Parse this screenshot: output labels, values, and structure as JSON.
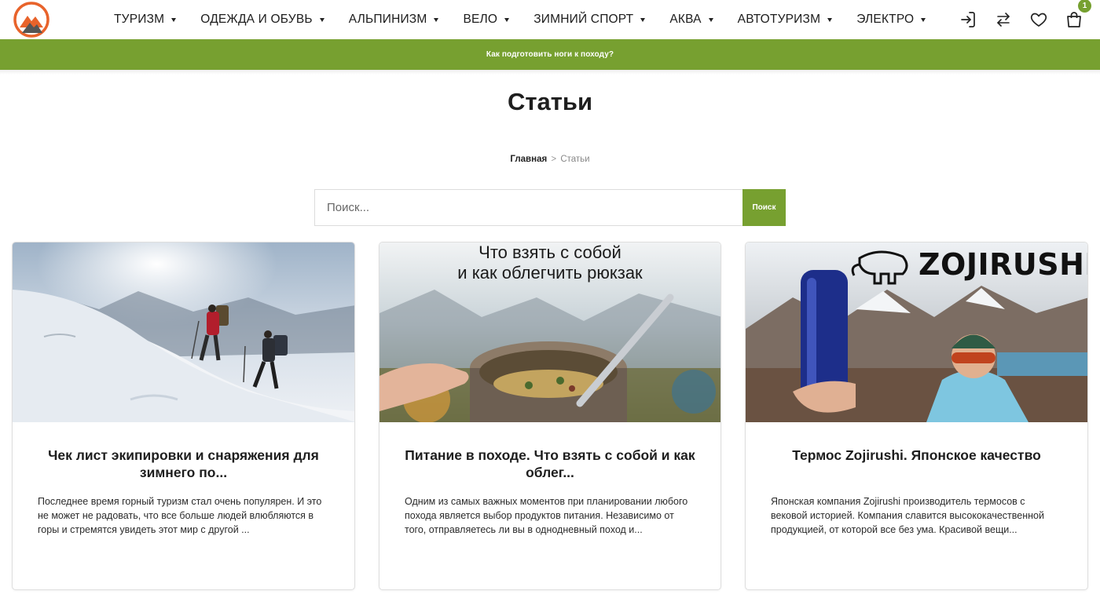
{
  "header": {
    "nav": [
      {
        "label": "ТУРИЗМ"
      },
      {
        "label": "ОДЕЖДА И ОБУВЬ"
      },
      {
        "label": "АЛЬПИНИЗМ"
      },
      {
        "label": "ВЕЛО"
      },
      {
        "label": "ЗИМНИЙ СПОРТ"
      },
      {
        "label": "АКВА"
      },
      {
        "label": "АВТОТУРИЗМ"
      },
      {
        "label": "ЭЛЕКТРО"
      }
    ],
    "icons": [
      "login-icon",
      "compare-icon",
      "heart-icon",
      "shopping-bag-icon"
    ],
    "cart_count": "1"
  },
  "promo": {
    "text": "Как подготовить ноги к походу?"
  },
  "page": {
    "title": "Статьи"
  },
  "breadcrumb": {
    "home": "Главная",
    "separator": ">",
    "current": "Статьи"
  },
  "search": {
    "placeholder": "Поиск...",
    "button_label": "Поиск"
  },
  "articles": [
    {
      "title": "Чек лист экипировки и снаряжения для зимнего по...",
      "excerpt": "Последнее время горный туризм стал очень популярен. И это не может не радовать, что все больше людей влюбляются в горы и стремятся увидеть этот мир с другой ..."
    },
    {
      "title": "Питание в походе. Что взять с собой и как облег...",
      "excerpt": "Одним из самых важных моментов при планировании любого похода является выбор продуктов питания. Независимо от того, отправляетесь ли вы в однодневный поход и...",
      "image_text_line1": "Что взять с собой",
      "image_text_line2": "и как облегчить рюкзак"
    },
    {
      "title": "Термос Zojirushi. Японское качество",
      "excerpt": "Японская компания Zojirushi производитель термосов с вековой историей. Компания славится высококачественной продукцией, от которой все без ума. Красивой вещи...",
      "image_brand": "ZOJIRUSHI"
    }
  ],
  "colors": {
    "accent": "#77a030",
    "logo_orange": "#e8632b",
    "logo_dark": "#555555"
  }
}
